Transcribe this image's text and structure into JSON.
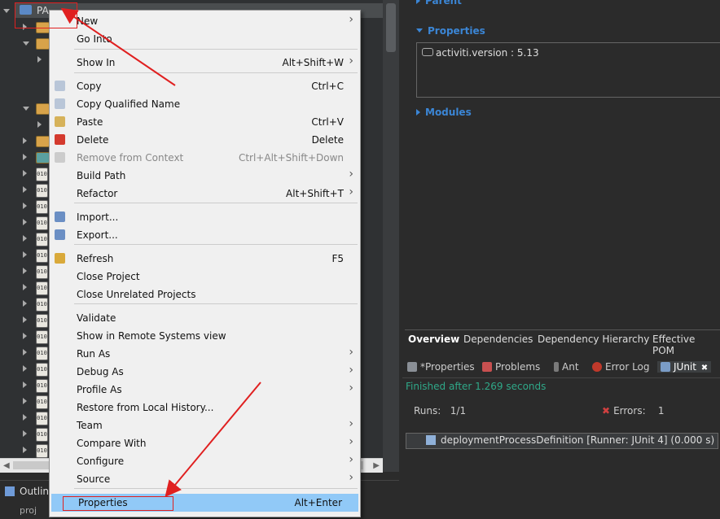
{
  "explorer": {
    "root_label": "PA…",
    "jar_label": "010"
  },
  "menu": {
    "items": [
      {
        "label": "New",
        "shortcut": "",
        "submenu": true
      },
      {
        "label": "Go Into",
        "shortcut": "",
        "submenu": false
      },
      {
        "label": "Show In",
        "shortcut": "Alt+Shift+W",
        "submenu": true
      },
      {
        "label": "Copy",
        "shortcut": "Ctrl+C",
        "submenu": false
      },
      {
        "label": "Copy Qualified Name",
        "shortcut": "",
        "submenu": false
      },
      {
        "label": "Paste",
        "shortcut": "Ctrl+V",
        "submenu": false
      },
      {
        "label": "Delete",
        "shortcut": "Delete",
        "submenu": false
      },
      {
        "label": "Remove from Context",
        "shortcut": "Ctrl+Alt+Shift+Down",
        "submenu": false,
        "disabled": true
      },
      {
        "label": "Build Path",
        "shortcut": "",
        "submenu": true
      },
      {
        "label": "Refactor",
        "shortcut": "Alt+Shift+T",
        "submenu": true
      },
      {
        "label": "Import...",
        "shortcut": "",
        "submenu": false
      },
      {
        "label": "Export...",
        "shortcut": "",
        "submenu": false
      },
      {
        "label": "Refresh",
        "shortcut": "F5",
        "submenu": false
      },
      {
        "label": "Close Project",
        "shortcut": "",
        "submenu": false
      },
      {
        "label": "Close Unrelated Projects",
        "shortcut": "",
        "submenu": false
      },
      {
        "label": "Validate",
        "shortcut": "",
        "submenu": false
      },
      {
        "label": "Show in Remote Systems view",
        "shortcut": "",
        "submenu": false
      },
      {
        "label": "Run As",
        "shortcut": "",
        "submenu": true
      },
      {
        "label": "Debug As",
        "shortcut": "",
        "submenu": true
      },
      {
        "label": "Profile As",
        "shortcut": "",
        "submenu": true
      },
      {
        "label": "Restore from Local History...",
        "shortcut": "",
        "submenu": false
      },
      {
        "label": "Team",
        "shortcut": "",
        "submenu": true
      },
      {
        "label": "Compare With",
        "shortcut": "",
        "submenu": true
      },
      {
        "label": "Configure",
        "shortcut": "",
        "submenu": true
      },
      {
        "label": "Source",
        "shortcut": "",
        "submenu": true
      },
      {
        "label": "Properties",
        "shortcut": "Alt+Enter",
        "submenu": false,
        "highlighted": true
      }
    ]
  },
  "pom": {
    "parent_label": "Parent",
    "properties_label": "Properties",
    "property_item": "activiti.version : 5.13",
    "modules_label": "Modules",
    "tabs": [
      "Overview",
      "Dependencies",
      "Dependency Hierarchy",
      "Effective POM"
    ]
  },
  "views": {
    "tabs": [
      "*Properties",
      "Problems",
      "Ant",
      "Error Log",
      "JUnit"
    ],
    "close_glyph": "✖",
    "status": "Finished after 1.269 seconds",
    "runs_label": "Runs:",
    "runs_value": "1/1",
    "errors_label": "Errors:",
    "errors_value": "1",
    "test_item": "deploymentProcessDefinition [Runner: JUnit 4] (0.000 s)"
  },
  "outline": {
    "label": "Outlin",
    "row": "proj"
  },
  "colors": {
    "menu_highlight": "#91c9f7",
    "annotation_red": "#e02020",
    "junit_green": "#2fa888",
    "section_blue": "#3b86d6"
  }
}
